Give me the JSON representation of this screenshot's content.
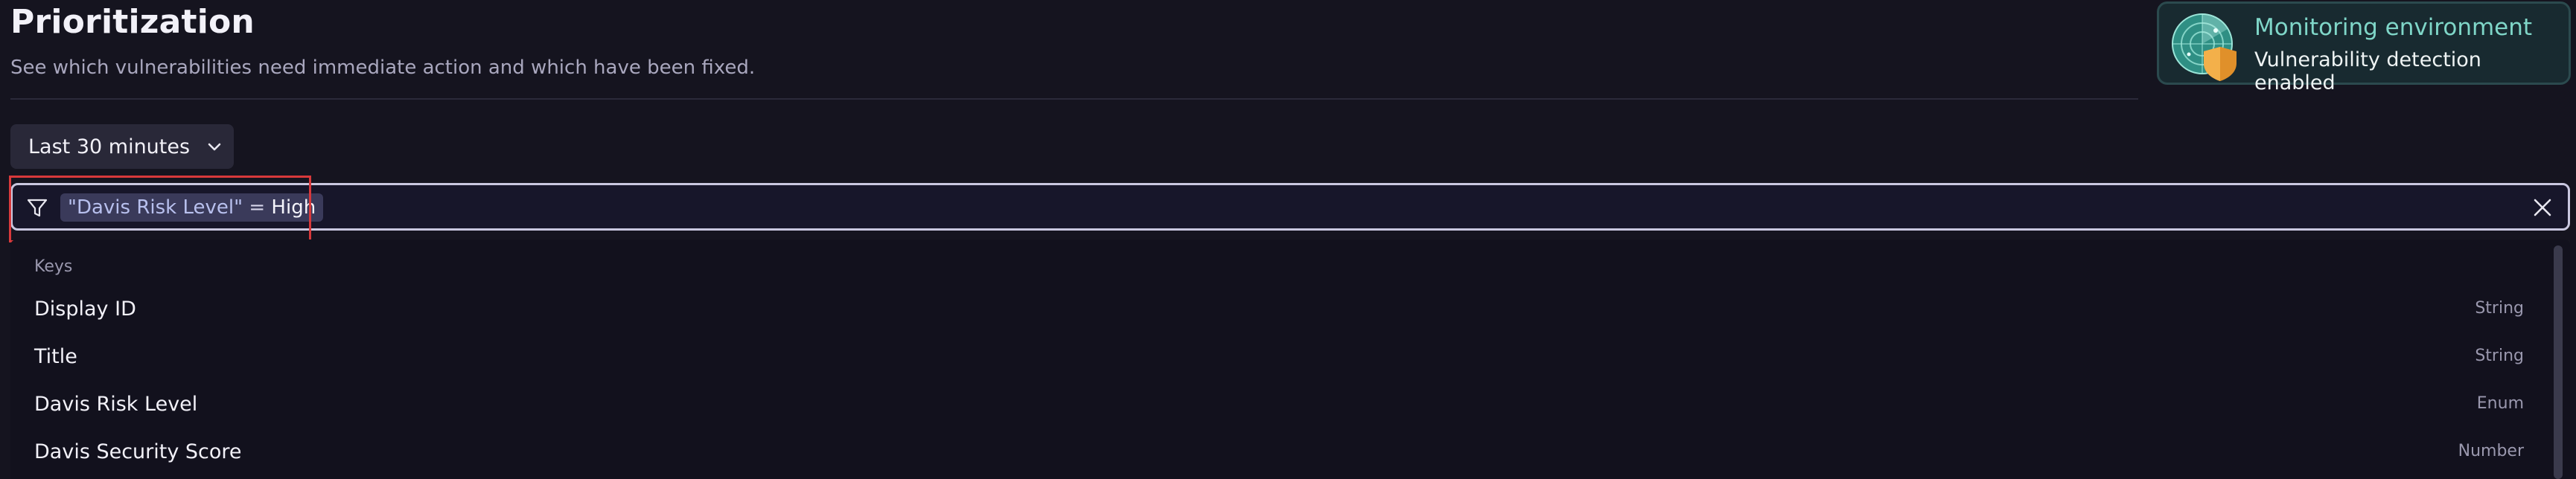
{
  "header": {
    "title": "Prioritization",
    "subtitle": "See which vulnerabilities need immediate action and which have been fixed."
  },
  "monitor_card": {
    "title": "Monitoring environment",
    "status": "Vulnerability detection enabled",
    "icon": "radar-shield-icon"
  },
  "timeframe": {
    "label": "Last 30 minutes",
    "icon": "chevron-down-icon"
  },
  "filter": {
    "icon": "filter-funnel-icon",
    "token_key": "\"Davis Risk Level\"",
    "token_operator": " = ",
    "token_value": "High",
    "clear_icon": "close-icon"
  },
  "suggestions": {
    "heading": "Keys",
    "items": [
      {
        "label": "Display ID",
        "type": "String"
      },
      {
        "label": "Title",
        "type": "String"
      },
      {
        "label": "Davis Risk Level",
        "type": "Enum"
      },
      {
        "label": "Davis Security Score",
        "type": "Number"
      }
    ]
  },
  "colors": {
    "background": "#15141f",
    "accent_teal": "#7fd6c8",
    "highlight_red": "#d8393b",
    "shield_orange": "#e0902a"
  }
}
